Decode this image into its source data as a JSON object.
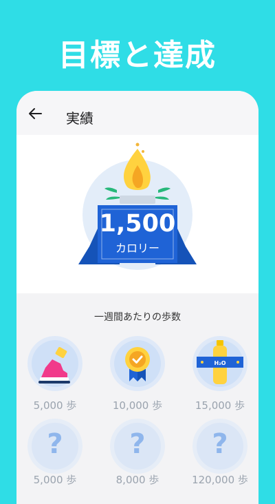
{
  "promo": {
    "headline": "目標と達成"
  },
  "appbar": {
    "back_icon": "arrow-left-icon",
    "title": "実績"
  },
  "hero": {
    "value": "1,500",
    "unit": "カロリー"
  },
  "section": {
    "title": "一週間あたりの歩数"
  },
  "badges": [
    {
      "label": "5,000 歩",
      "icon": "shoe-icon"
    },
    {
      "label": "10,000 歩",
      "icon": "medal-icon"
    },
    {
      "label": "15,000 歩",
      "icon": "water-bottle-icon"
    },
    {
      "label": "5,000 歩",
      "icon": "question-icon",
      "mark": "?"
    },
    {
      "label": "8,000 歩",
      "icon": "question-icon",
      "mark": "?"
    },
    {
      "label": "120,000 歩",
      "icon": "question-icon",
      "mark": "?"
    }
  ],
  "colors": {
    "background": "#2fdde6",
    "ribbon": "#1f63d6",
    "flame": "#ffd23f",
    "badge_locked": "#8fb6ec"
  }
}
